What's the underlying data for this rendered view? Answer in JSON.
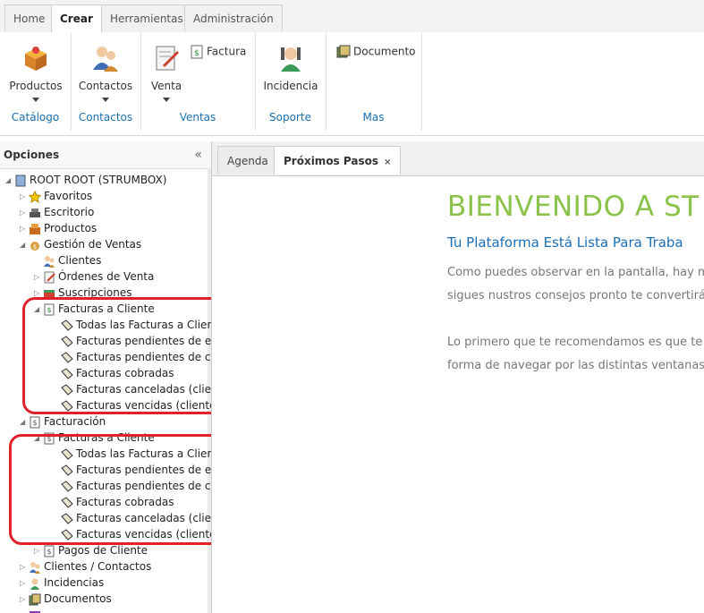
{
  "tabs": [
    "Home",
    "Crear",
    "Herramientas",
    "Administración"
  ],
  "ribbon": {
    "productos": "Productos",
    "contactos": "Contactos",
    "venta": "Venta",
    "factura": "Factura",
    "incidencia": "Incidencia",
    "documento": "Documento",
    "groups": [
      "Catálogo",
      "Contactos",
      "Ventas",
      "Soporte",
      "Mas"
    ]
  },
  "left_panel": {
    "title": "Opciones",
    "collapse": "«",
    "tree": {
      "root": "ROOT ROOT (STRUMBOX)",
      "favoritos": "Favoritos",
      "escritorio": "Escritorio",
      "productos": "Productos",
      "gestion_ventas": "Gestión de Ventas",
      "clientes": "Clientes",
      "ordenes": "Órdenes de Venta",
      "suscripciones": "Suscripciones",
      "facturas_cliente_1": "Facturas a Cliente",
      "f1_items": [
        "Todas las Facturas a Cliente",
        "Facturas pendientes de env",
        "Facturas pendientes de cob",
        "Facturas cobradas",
        "Facturas canceladas (cliente",
        "Facturas vencidas (cliente)"
      ],
      "facturacion": "Facturación",
      "facturas_cliente_2": "Facturas a Cliente",
      "f2_items": [
        "Todas las Facturas a Cliente",
        "Facturas pendientes de env",
        "Facturas pendientes de cob",
        "Facturas cobradas",
        "Facturas canceladas (cliente",
        "Facturas vencidas (cliente)"
      ],
      "pagos": "Pagos de Cliente",
      "clientes_contactos": "Clientes / Contactos",
      "incidencias": "Incidencias",
      "documentos": "Documentos"
    }
  },
  "content": {
    "tabs": [
      "Agenda",
      "Próximos Pasos"
    ],
    "close_glyph": "×",
    "title": "BIENVENIDO A ST",
    "subtitle": "Tu Plataforma Está Lista Para Traba",
    "p1_line1": "Como puedes observar en la pantalla, hay m",
    "p1_line2": "sigues nustros consejos pronto te convertirás",
    "p2_line1": "Lo primero que te recomendamos es que te",
    "p2_line2": "forma de navegar por las distintas ventanas."
  },
  "colors": {
    "accent_green": "#8bc34a",
    "link_blue": "#1c6fb5",
    "highlight_red": "#e0202a"
  }
}
